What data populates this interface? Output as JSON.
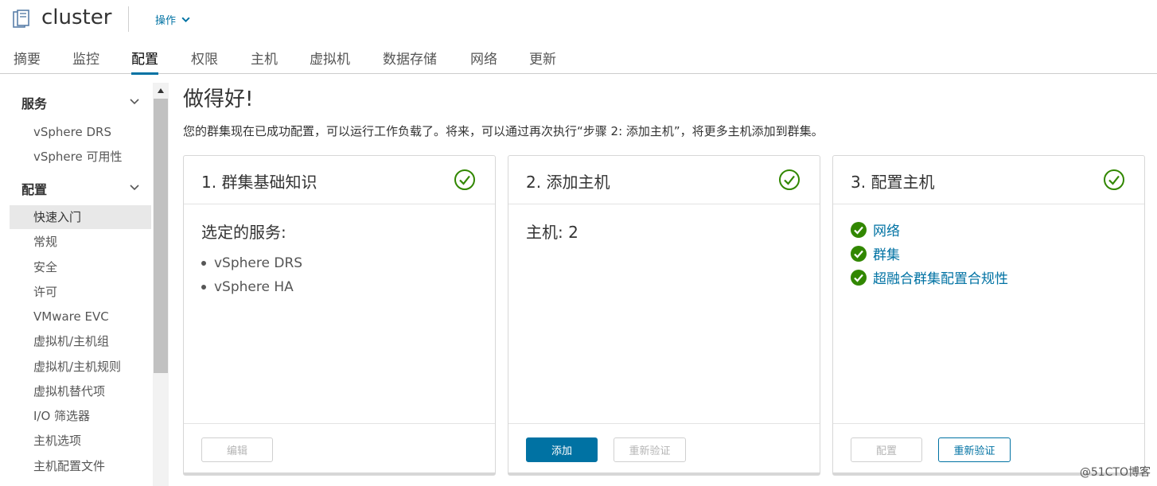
{
  "header": {
    "object_title": "cluster",
    "actions_label": "操作",
    "object_icon": "cluster-icon"
  },
  "tabs": [
    {
      "label": "摘要"
    },
    {
      "label": "监控"
    },
    {
      "label": "配置",
      "active": true
    },
    {
      "label": "权限"
    },
    {
      "label": "主机"
    },
    {
      "label": "虚拟机"
    },
    {
      "label": "数据存储"
    },
    {
      "label": "网络"
    },
    {
      "label": "更新"
    }
  ],
  "sidebar": {
    "groups": [
      {
        "label": "服务",
        "items": [
          "vSphere DRS",
          "vSphere 可用性"
        ]
      },
      {
        "label": "配置",
        "items": [
          "快速入门",
          "常规",
          "安全",
          "许可",
          "VMware EVC",
          "虚拟机/主机组",
          "虚拟机/主机规则",
          "虚拟机替代项",
          "I/O 筛选器",
          "主机选项",
          "主机配置文件"
        ]
      }
    ],
    "selected": "快速入门"
  },
  "main": {
    "title": "做得好!",
    "description": "您的群集现在已成功配置，可以运行工作负载了。将来，可以通过再次执行“步骤 2: 添加主机”，将更多主机添加到群集。"
  },
  "cards": [
    {
      "title": "1. 群集基础知识",
      "subtitle": "选定的服务:",
      "services": [
        "vSphere DRS",
        "vSphere HA"
      ],
      "buttons": [
        {
          "label": "编辑",
          "style": "disabled"
        }
      ]
    },
    {
      "title": "2. 添加主机",
      "subtitle": "主机: 2",
      "buttons": [
        {
          "label": "添加",
          "style": "primary"
        },
        {
          "label": "重新验证",
          "style": "disabled"
        }
      ]
    },
    {
      "title": "3. 配置主机",
      "links": [
        "网络",
        "群集",
        "超融合群集配置合规性"
      ],
      "buttons": [
        {
          "label": "配置",
          "style": "disabled"
        },
        {
          "label": "重新验证",
          "style": "outline"
        }
      ]
    }
  ],
  "watermark": "@51CTO博客",
  "colors": {
    "accent": "#0072a3",
    "success": "#318700",
    "text": "#333333"
  }
}
